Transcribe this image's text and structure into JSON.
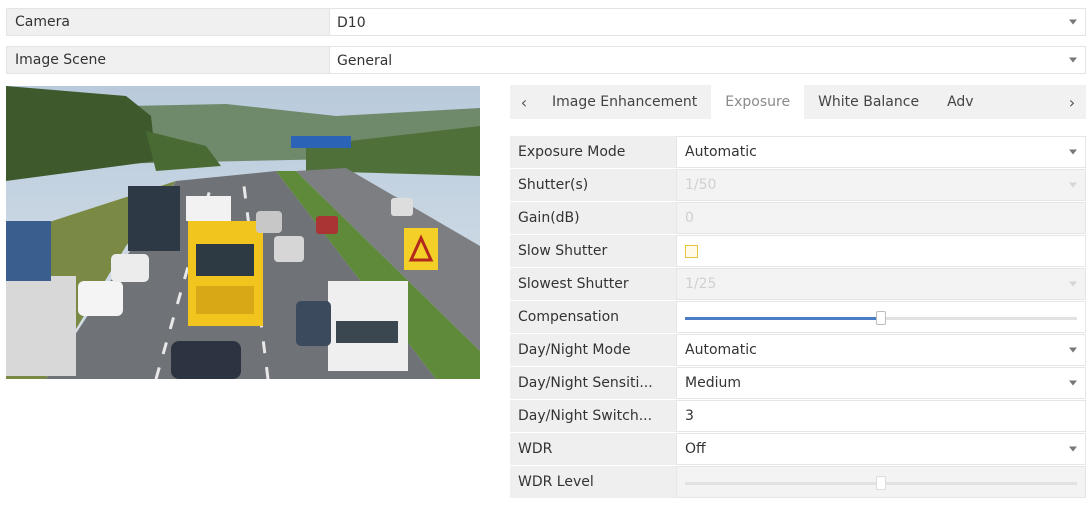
{
  "camera": {
    "label": "Camera",
    "value": "D10"
  },
  "scene": {
    "label": "Image Scene",
    "value": "General"
  },
  "tabs": {
    "left_arrow": "‹",
    "right_arrow": "›",
    "items": [
      {
        "label": "Image Enhancement",
        "active": false
      },
      {
        "label": "Exposure",
        "active": true
      },
      {
        "label": "White Balance",
        "active": false
      },
      {
        "label": "Adv",
        "active": false
      }
    ]
  },
  "form": {
    "exposure_mode": {
      "label": "Exposure Mode",
      "value": "Automatic"
    },
    "shutter": {
      "label": "Shutter(s)",
      "value": "1/50"
    },
    "gain": {
      "label": "Gain(dB)",
      "value": "0"
    },
    "slow_shutter": {
      "label": "Slow Shutter",
      "checked": false
    },
    "slowest_shutter": {
      "label": "Slowest Shutter",
      "value": "1/25"
    },
    "compensation": {
      "label": "Compensation",
      "level": 0.5
    },
    "day_night_mode": {
      "label": "Day/Night Mode",
      "value": "Automatic"
    },
    "day_night_sensitivity": {
      "label": "Day/Night Sensiti...",
      "value": "Medium"
    },
    "day_night_switch": {
      "label": "Day/Night Switch...",
      "value": "3"
    },
    "wdr": {
      "label": "WDR",
      "value": "Off"
    },
    "wdr_level": {
      "label": "WDR Level",
      "level": 0.5
    }
  },
  "colors": {
    "accent": "#4a7dc4",
    "label_bg": "#efefef",
    "checkbox_border": "#e4c340"
  }
}
